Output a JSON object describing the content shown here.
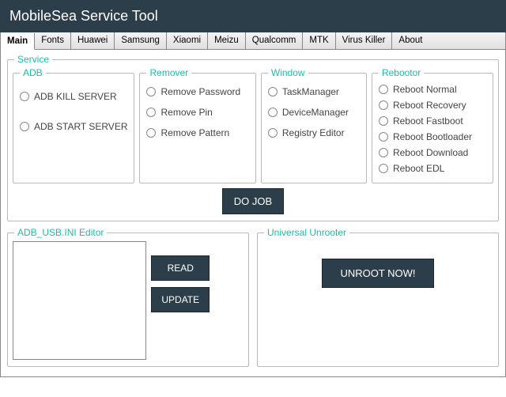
{
  "title": "MobileSea Service Tool",
  "tabs": [
    "Main",
    "Fonts",
    "Huawei",
    "Samsung",
    "Xiaomi",
    "Meizu",
    "Qualcomm",
    "MTK",
    "Virus Killer",
    "About"
  ],
  "service": {
    "legend": "Service",
    "adb": {
      "legend": "ADB",
      "items": [
        "ADB KILL SERVER",
        "ADB START SERVER"
      ]
    },
    "remover": {
      "legend": "Remover",
      "items": [
        "Remove Password",
        "Remove Pin",
        "Remove Pattern"
      ]
    },
    "window": {
      "legend": "Window",
      "items": [
        "TaskManager",
        "DeviceManager",
        "Registry Editor"
      ]
    },
    "rebootor": {
      "legend": "Rebootor",
      "items": [
        "Reboot Normal",
        "Reboot Recovery",
        "Reboot Fastboot",
        "Reboot Bootloader",
        "Reboot Download",
        "Reboot EDL"
      ]
    },
    "dojob": "DO JOB"
  },
  "adb_editor": {
    "legend": "ADB_USB.INI Editor",
    "read": "READ",
    "update": "UPDATE"
  },
  "unrooter": {
    "legend": "Universal Unrooter",
    "button": "UNROOT NOW!"
  }
}
